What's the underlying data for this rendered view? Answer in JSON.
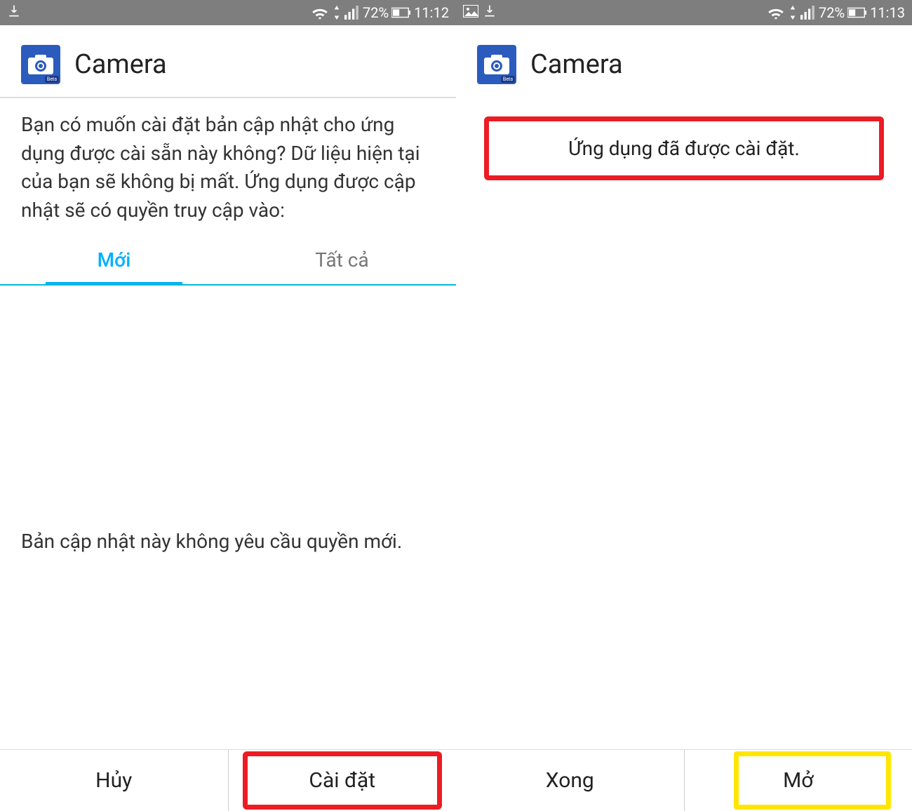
{
  "left": {
    "status": {
      "battery_pct": "72%",
      "time": "11:12"
    },
    "app_name": "Camera",
    "install_prompt": "Bạn có muốn cài đặt bản cập nhật cho ứng dụng được cài sẵn này không? Dữ liệu hiện tại của bạn sẽ không bị mất. Ứng dụng được cập nhật sẽ có quyền truy cập vào:",
    "tabs": {
      "new": "Mới",
      "all": "Tất cả"
    },
    "no_new_permissions": "Bản cập nhật này không yêu cầu quyền mới.",
    "buttons": {
      "cancel": "Hủy",
      "install": "Cài đặt"
    }
  },
  "right": {
    "status": {
      "battery_pct": "72%",
      "time": "11:13"
    },
    "app_name": "Camera",
    "installed_message": "Ứng dụng đã được cài đặt.",
    "buttons": {
      "done": "Xong",
      "open": "Mở"
    }
  },
  "icons": {
    "app_beta_label": "Beta"
  }
}
